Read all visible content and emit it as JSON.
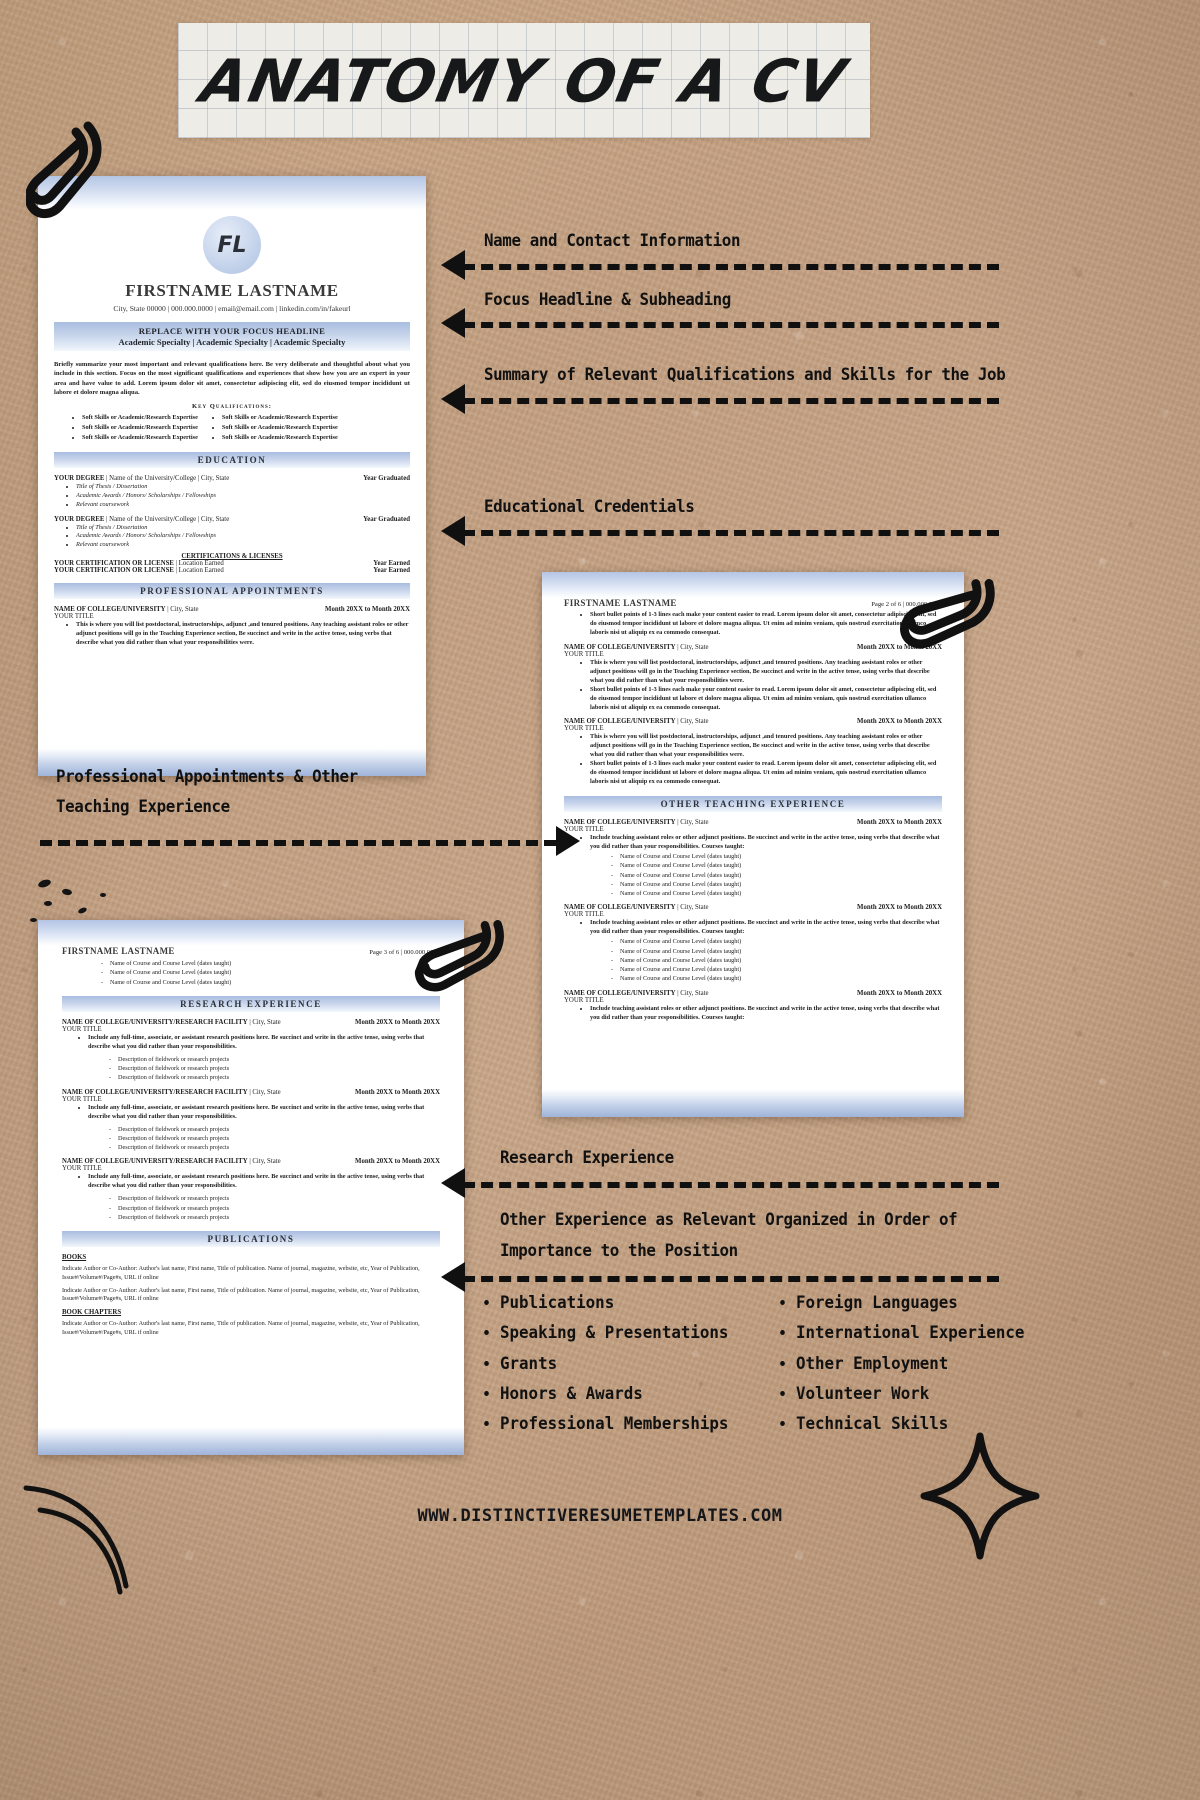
{
  "title": "ANATOMY OF A CV",
  "footer_url": "WWW.DISTINCTIVERESUMETEMPLATES.COM",
  "colors": {
    "accent_blue": "#a9bde0",
    "kraft": "#c2a07f",
    "ink": "#101010",
    "paper": "#ffffff"
  },
  "annotations": [
    {
      "id": "name-contact",
      "label": "Name and Contact Information"
    },
    {
      "id": "focus-headline",
      "label": "Focus Headline & Subheading"
    },
    {
      "id": "summary",
      "label": "Summary of Relevant Qualifications and Skills for the Job"
    },
    {
      "id": "education",
      "label": "Educational Credentials"
    },
    {
      "id": "appointments-l1",
      "label": "Professional Appointments & Other"
    },
    {
      "id": "appointments-l2",
      "label": "Teaching Experience"
    },
    {
      "id": "research",
      "label": "Research Experience"
    },
    {
      "id": "other-l1",
      "label": "Other Experience as Relevant Organized in Order of"
    },
    {
      "id": "other-l2",
      "label": "Importance to the Position"
    }
  ],
  "bottom_lists": {
    "left": [
      "Publications",
      "Speaking & Presentations",
      "Grants",
      "Honors & Awards",
      "Professional Memberships"
    ],
    "right": [
      "Foreign Languages",
      "International Experience",
      "Other Employment",
      "Volunteer Work",
      "Technical Skills"
    ]
  },
  "page1": {
    "monogram": "FL",
    "name": "FIRSTNAME LASTNAME",
    "contact": "City, State 00000 | 000.000.0000 | email@email.com | linkedin.com/in/fakeurl",
    "headline": "REPLACE WITH YOUR FOCUS HEADLINE",
    "subheading": "Academic Specialty  |  Academic Specialty  |  Academic Specialty",
    "summary": "Briefly summarize your most important and relevant qualifications here. Be very deliberate and thoughtful about what you include in this section. Focus on the most significant qualifications and experiences that show how you are an expert in your area and have value to add. Lorem ipsum dolor sit amet, consectetur adipiscing elit, sed do eiusmod tempor incididunt ut labore et dolore magna aliqua.",
    "key_qual_title": "Key Qualifications:",
    "key_qual_left": [
      "Soft Skills or Academic/Research Expertise",
      "Soft Skills or Academic/Research Expertise",
      "Soft Skills or Academic/Research Expertise"
    ],
    "key_qual_right": [
      "Soft Skills or Academic/Research Expertise",
      "Soft Skills or Academic/Research Expertise",
      "Soft Skills or Academic/Research Expertise"
    ],
    "education_heading": "EDUCATION",
    "degrees": [
      {
        "degree": "YOUR DEGREE",
        "org": " | Name of the University/College | City, State",
        "date": "Year Graduated",
        "bullets": [
          "Title of Thesis / Dissertation",
          "Academic Awards / Honors/ Scholarships / Fellowships",
          "Relevant coursework"
        ]
      },
      {
        "degree": "YOUR DEGREE",
        "org": " | Name of the University/College | City, State",
        "date": "Year Graduated",
        "bullets": [
          "Title of Thesis / Dissertation",
          "Academic Awards / Honors/ Scholarships / Fellowships",
          "Relevant coursework"
        ]
      }
    ],
    "cert_heading": "CERTIFICATIONS & LICENSES",
    "certs": [
      {
        "name": "YOUR CERTIFICATION OR LICENSE",
        "loc": " | Location Earned",
        "date": "Year Earned"
      },
      {
        "name": "YOUR CERTIFICATION OR LICENSE",
        "loc": " | Location Earned",
        "date": "Year Earned"
      }
    ],
    "appointments_heading": "PROFESSIONAL APPOINTMENTS",
    "appointment": {
      "org": "NAME OF COLLEGE/UNIVERSITY",
      "loc": " | City, State",
      "date": "Month 20XX to Month 20XX",
      "title": "YOUR TITLE",
      "bullet": "This is where you will list postdoctoral, instructorships, adjunct ,and tenured positions. Any teaching assistant roles or other adjunct positions will go in the Teaching Experience section, Be succinct and write in the active tense, using verbs that describe what you did rather than what your responsibilities were."
    }
  },
  "page2": {
    "name": "FIRSTNAME LASTNAME",
    "page_label": "Page 2 of 6 | 000.000.0000",
    "lead_bullet": "Short bullet points of 1-3 lines each make your content easier to read.  Lorem ipsum dolor sit amet, consectetur adipiscing elit, sed do eiusmod tempor incididunt ut labore et dolore magna aliqua. Ut enim ad minim veniam, quis nostrud exercitation ullamco laboris nisi ut aliquip ex ea commodo consequat.",
    "entries": [
      {
        "org": "NAME OF COLLEGE/UNIVERSITY",
        "loc": " | City, State",
        "date": "Month 20XX to Month 20XX",
        "title": "YOUR TITLE",
        "bullets": [
          "This is where you will list postdoctoral, instructorships, adjunct ,and tenured positions. Any teaching assistant roles or other adjunct positions will go in the Teaching Experience section, Be succinct and write in the active tense, using verbs that describe what you did rather than what your responsibilities were.",
          "Short bullet points of 1-3 lines each make your content easier to read. Lorem ipsum dolor sit amet, consectetur adipiscing elit, sed do eiusmod tempor incididunt ut labore et dolore magna aliqua. Ut enim ad minim veniam, quis nostrud exercitation ullamco laboris nisi ut aliquip ex ea commodo consequat."
        ]
      },
      {
        "org": "NAME OF COLLEGE/UNIVERSITY",
        "loc": " | City, State",
        "date": "Month 20XX to Month 20XX",
        "title": "YOUR TITLE",
        "bullets": [
          "This is where you will list postdoctoral, instructorships, adjunct ,and tenured positions. Any teaching assistant roles or other adjunct positions will go in the Teaching Experience section, Be succinct and write in the active tense, using verbs that describe what you did rather than what your responsibilities were.",
          "Short bullet points of 1-3 lines each make your content easier to read. Lorem ipsum dolor sit amet, consectetur adipiscing elit, sed do eiusmod tempor incididunt ut labore et dolore magna aliqua. Ut enim ad minim veniam, quis nostrud exercitation ullamco laboris nisi ut aliquip ex ea commodo consequat."
        ]
      }
    ],
    "teaching_heading": "OTHER TEACHING EXPERIENCE",
    "teaching": [
      {
        "org": "NAME OF COLLEGE/UNIVERSITY",
        "loc": " | City, State",
        "date": "Month 20XX to Month 20XX",
        "title": "YOUR TITLE",
        "bullet": "Include teaching assistant roles or other adjunct positions. Be succinct and write in the active tense, using verbs that describe what you did rather than your responsibilities. Courses taught:",
        "courses": [
          "Name of Course and Course Level (dates taught)",
          "Name of Course and Course Level (dates taught)",
          "Name of Course and Course Level (dates taught)",
          "Name of Course and Course Level (dates taught)",
          "Name of Course and Course Level (dates taught)"
        ]
      },
      {
        "org": "NAME OF COLLEGE/UNIVERSITY",
        "loc": " | City, State",
        "date": "Month 20XX to Month 20XX",
        "title": "YOUR TITLE",
        "bullet": "Include teaching assistant roles or other adjunct positions. Be succinct and write in the active tense, using verbs that describe what you did rather than your responsibilities. Courses taught:",
        "courses": [
          "Name of Course and Course Level (dates taught)",
          "Name of Course and Course Level (dates taught)",
          "Name of Course and Course Level (dates taught)",
          "Name of Course and Course Level (dates taught)",
          "Name of Course and Course Level (dates taught)"
        ]
      },
      {
        "org": "NAME OF COLLEGE/UNIVERSITY",
        "loc": " | City, State",
        "date": "Month 20XX to Month 20XX",
        "title": "YOUR TITLE",
        "bullet": "Include teaching assistant roles or other adjunct positions. Be succinct and write in the active tense, using verbs that describe what you did rather than your responsibilities. Courses taught:",
        "courses": []
      }
    ]
  },
  "page3": {
    "name": "FIRSTNAME LASTNAME",
    "page_label": "Page 3 of 6 | 000.000.0000",
    "top_courses": [
      "Name of Course and Course Level (dates taught)",
      "Name of Course and Course Level (dates taught)",
      "Name of Course and Course Level (dates taught)"
    ],
    "research_heading": "RESEARCH EXPERIENCE",
    "research": [
      {
        "org": "NAME OF COLLEGE/UNIVERSITY/RESEARCH FACILITY",
        "loc": " | City, State",
        "date": "Month 20XX to Month 20XX",
        "title": "YOUR TITLE",
        "bullet": "Include any full-time, associate, or assistant research positions here. Be succinct and write in the active tense, using verbs that describe what you did rather than your responsibilities.",
        "subs": [
          "Description of fieldwork or research projects",
          "Description of fieldwork or research projects",
          "Description of fieldwork or research projects"
        ]
      },
      {
        "org": "NAME OF COLLEGE/UNIVERSITY/RESEARCH FACILITY",
        "loc": " | City, State",
        "date": "Month 20XX to Month 20XX",
        "title": "YOUR TITLE",
        "bullet": "Include any full-time, associate, or assistant research positions here. Be succinct and write in the active tense, using verbs that describe what you did rather than your responsibilities.",
        "subs": [
          "Description of fieldwork or research projects",
          "Description of fieldwork or research projects",
          "Description of fieldwork or research projects"
        ]
      },
      {
        "org": "NAME OF COLLEGE/UNIVERSITY/RESEARCH FACILITY",
        "loc": " | City, State",
        "date": "Month 20XX to Month 20XX",
        "title": "YOUR TITLE",
        "bullet": "Include any full-time, associate, or assistant research positions here. Be succinct and write in the active tense, using verbs that describe what you did rather than your responsibilities.",
        "subs": [
          "Description of fieldwork or research projects",
          "Description of fieldwork or research projects",
          "Description of fieldwork or research projects"
        ]
      }
    ],
    "publications_heading": "PUBLICATIONS",
    "books_heading": "BOOKS",
    "book_entries": [
      "Indicate Author or Co-Author: Author's last name, First name, Title of publication. Name of journal, magazine, website, etc, Year of Publication, Issue#/Volume#/Page#s, URL if online",
      "Indicate Author or Co-Author: Author's last name, First name, Title of publication. Name of journal, magazine, website, etc, Year of Publication, Issue#/Volume#/Page#s, URL if online"
    ],
    "chapters_heading": "BOOK CHAPTERS",
    "chapter_entries": [
      "Indicate Author or Co-Author: Author's last name, First name, Title of publication. Name of journal, magazine, website, etc, Year of Publication, Issue#/Volume#/Page#s, URL if online"
    ]
  }
}
